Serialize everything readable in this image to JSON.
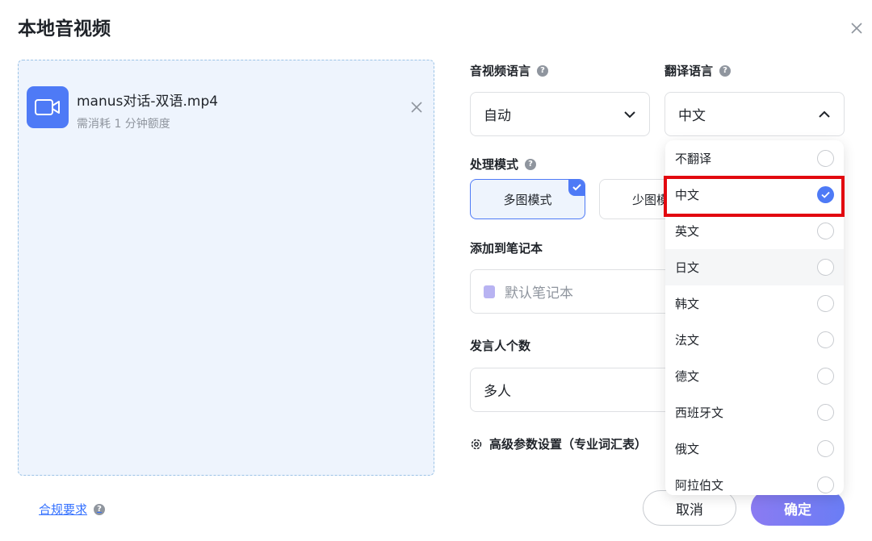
{
  "dialog": {
    "title": "本地音视频",
    "close_icon": "close-icon"
  },
  "file": {
    "name": "manus对话-双语.mp4",
    "quota_note": "需消耗 1 分钟额度",
    "icon": "video-camera-icon"
  },
  "form": {
    "audio_lang": {
      "label": "音视频语言",
      "value": "自动"
    },
    "translate_lang": {
      "label": "翻译语言",
      "value": "中文"
    },
    "mode": {
      "label": "处理模式",
      "options": [
        "多图模式",
        "少图模式"
      ],
      "selected": "多图模式",
      "visible_second": "少图模"
    },
    "notebook": {
      "label": "添加到笔记本",
      "placeholder": "默认笔记本"
    },
    "speakers": {
      "label": "发言人个数",
      "value": "多人"
    },
    "advanced": {
      "label": "高级参数设置（专业词汇表）"
    }
  },
  "dropdown": {
    "options": [
      "不翻译",
      "中文",
      "英文",
      "日文",
      "韩文",
      "法文",
      "德文",
      "西班牙文",
      "俄文",
      "阿拉伯文"
    ],
    "selected": "中文",
    "hovered": "日文"
  },
  "footer": {
    "compliance": "合规要求",
    "cancel": "取消",
    "confirm": "确定"
  },
  "colors": {
    "accent": "#4e7af6",
    "highlight_box": "#e2080f",
    "link": "#3370ff"
  }
}
